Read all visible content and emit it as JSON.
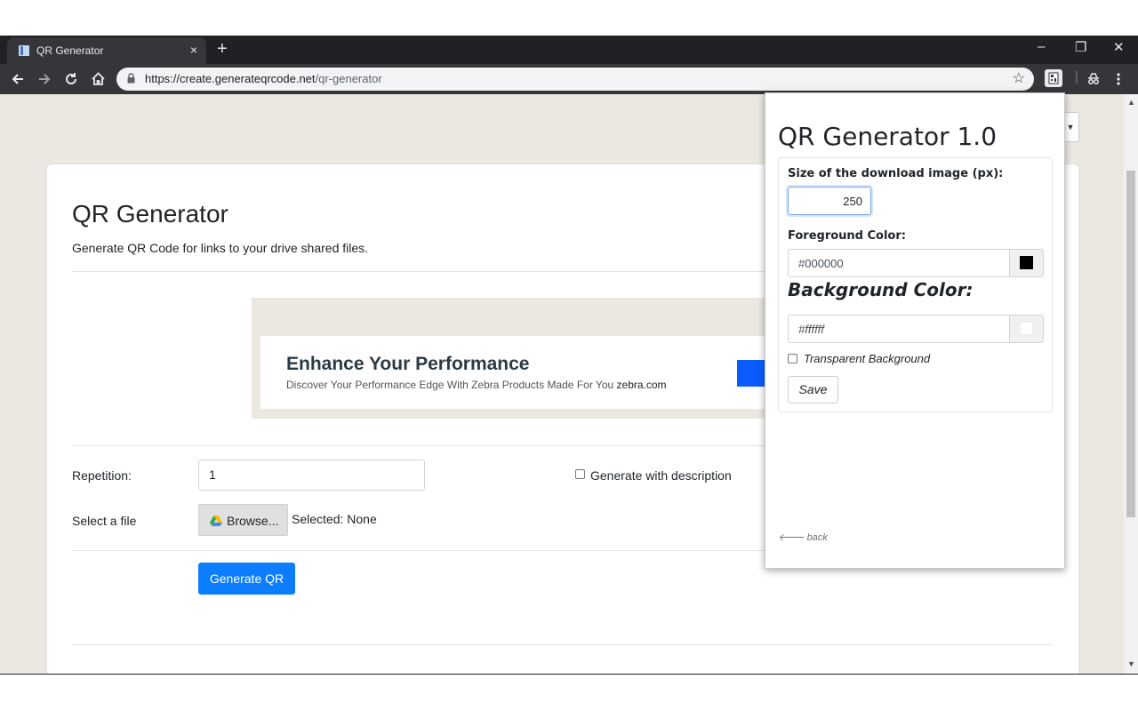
{
  "browser": {
    "tab_title": "QR Generator",
    "tab_close": "×",
    "new_tab": "+",
    "minimize": "–",
    "restore": "❐",
    "close": "✕",
    "url_host": "https://create.generateqrcode.net",
    "url_path": "/qr-generator",
    "icons": [
      "back-arrow",
      "forward-arrow",
      "reload",
      "home",
      "lock",
      "star",
      "extension",
      "incognito",
      "menu"
    ]
  },
  "page": {
    "title": "QR Generator",
    "subtitle": "Generate QR Code for links to your drive shared files.",
    "ad": {
      "headline": "Enhance Your Performance",
      "description": "Discover Your Performance Edge With Zebra Products Made For You",
      "domain": "zebra.com"
    },
    "form": {
      "repetition_label": "Repetition:",
      "repetition_value": "1",
      "describe_label": "Generate with description",
      "file_label": "Select a file",
      "browse_label": "Browse...",
      "selected_text": "Selected: None",
      "generate_label": "Generate QR"
    }
  },
  "popup": {
    "title": "QR Generator 1.0",
    "size_label": "Size of the download image (px):",
    "size_value": "250",
    "fg_label": "Foreground Color:",
    "fg_value": "#000000",
    "bg_label": "Background Color:",
    "bg_value": "#ffffff",
    "transparent_label": "Transparent Background",
    "save_label": "Save",
    "back_label": "back",
    "back_arrow": "🡐"
  },
  "colors": {
    "primary": "#0d7dff",
    "chrome_dark": "#35363a",
    "page_bg": "#ebe8e2"
  }
}
